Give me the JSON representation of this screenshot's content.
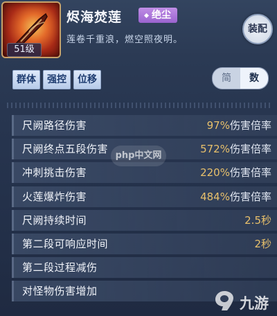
{
  "skill": {
    "level": "51级",
    "name": "烬海焚莲",
    "tag": "绝尘",
    "description": "莲卷千重浪，燃空照夜明。",
    "equip_label": "装配"
  },
  "categories": [
    "群体",
    "强控",
    "位移"
  ],
  "view_toggle": {
    "simple": "简",
    "number": "数",
    "selected": "数"
  },
  "stats": [
    {
      "name": "尺阙路径伤害",
      "value_num": "97%",
      "value_suffix": "伤害倍率"
    },
    {
      "name": "尺阙终点五段伤害",
      "value_num": "572%",
      "value_suffix": "伤害倍率"
    },
    {
      "name": "冲刺挑击伤害",
      "value_num": "220%",
      "value_suffix": "伤害倍率"
    },
    {
      "name": "火莲爆炸伤害",
      "value_num": "484%",
      "value_suffix": "伤害倍率"
    },
    {
      "name": "尺阙持续时间",
      "value_num": "2.5秒",
      "value_suffix": ""
    },
    {
      "name": "第二段可响应时间",
      "value_num": "2秒",
      "value_suffix": ""
    },
    {
      "name": "第二段过程减伤",
      "value_num": "",
      "value_suffix": ""
    },
    {
      "name": "对怪物伤害增加",
      "value_num": "",
      "value_suffix": ""
    }
  ],
  "watermarks": {
    "php": "php中文网",
    "nine": "九游"
  },
  "colors": {
    "accent_purple": "#b07ddc",
    "value_gold": "#e8c06b",
    "icon_red": "#c13a1f"
  },
  "icons": {
    "skill": "flaming-blade-icon",
    "nine_logo": "9-logo-icon"
  }
}
